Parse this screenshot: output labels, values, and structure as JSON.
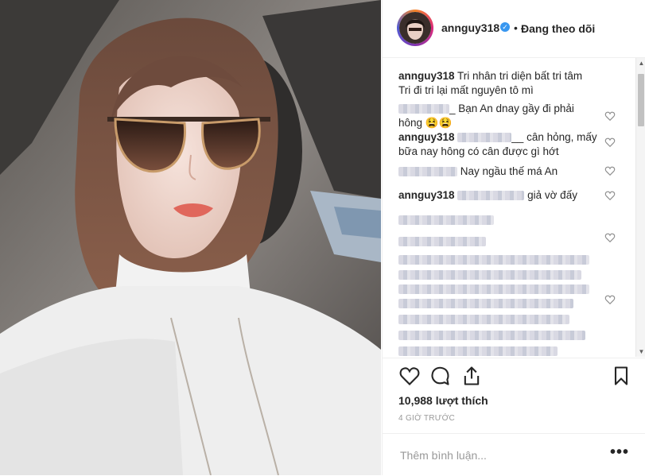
{
  "post": {
    "username": "annguy318",
    "follow_status": "Đang theo dõi",
    "likes_text": "10,988 lượt thích",
    "time_text": "4 GIỜ TRƯỚC",
    "comment_placeholder": "Thêm bình luận...",
    "more_label": "•••"
  },
  "caption": {
    "user": "annguy318",
    "line1": "Tri nhân tri diện bất tri tâm",
    "line2": "Tri đi tri lại mất nguyên tô mì"
  },
  "comments": [
    {
      "user": "",
      "text": "_ Bạn An dnay gầy đi phải",
      "text2": "hông 😫😫"
    },
    {
      "user": "annguy318",
      "text": "__ cân hỏng, mấy",
      "text2": "bữa nay hông có cân được gì hớt"
    },
    {
      "user": "",
      "text": "Nay ngầu thế má An"
    },
    {
      "user": "annguy318",
      "text": "giả vờ đấy"
    }
  ],
  "icons": {
    "heart": "heart-icon",
    "comment": "comment-icon",
    "share": "share-icon",
    "save": "bookmark-icon",
    "verified": "verified-badge-icon"
  },
  "colors": {
    "accent": "#3897f0",
    "text": "#262626",
    "muted": "#999999"
  }
}
